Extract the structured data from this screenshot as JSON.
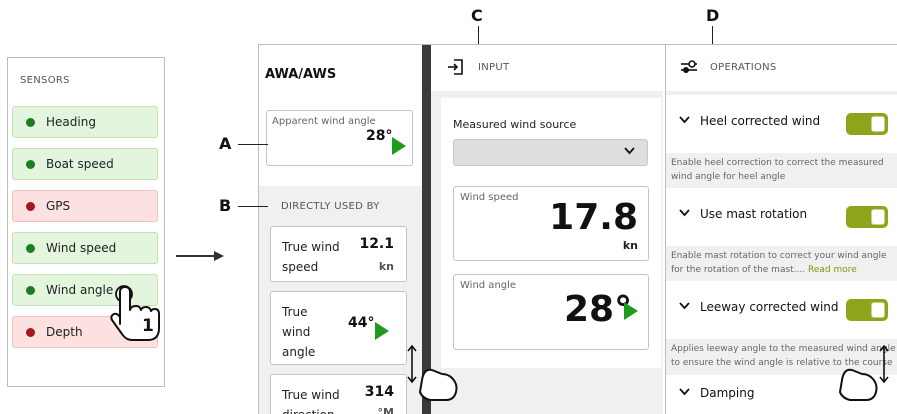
{
  "sensors": {
    "title": "SENSORS",
    "items": [
      {
        "label": "Heading",
        "status": "ok"
      },
      {
        "label": "Boat speed",
        "status": "ok"
      },
      {
        "label": "GPS",
        "status": "error"
      },
      {
        "label": "Wind speed",
        "status": "ok"
      },
      {
        "label": "Wind angle",
        "status": "ok"
      },
      {
        "label": "Depth",
        "status": "error"
      }
    ],
    "touch_step": "1"
  },
  "callouts": {
    "a": "A",
    "b": "B",
    "c": "C",
    "d": "D"
  },
  "column1": {
    "title": "AWA/AWS",
    "apparent_wind": {
      "label": "Apparent wind angle",
      "value": "28°"
    },
    "directly_used_by": {
      "title": "DIRECTLY USED BY",
      "cards": [
        {
          "name": "True wind speed",
          "value": "12.1",
          "unit": "kn"
        },
        {
          "name": "True wind angle",
          "value": "44°"
        },
        {
          "name": "True wind direction",
          "value": "314",
          "unit": "°M"
        }
      ]
    }
  },
  "column2": {
    "header": "INPUT",
    "source_label": "Measured wind source",
    "source_value": "",
    "wind_speed": {
      "label": "Wind speed",
      "value": "17.8",
      "unit": "kn"
    },
    "wind_angle": {
      "label": "Wind angle",
      "value": "28°"
    }
  },
  "column3": {
    "header": "OPERATIONS",
    "operations": [
      {
        "name": "Heel corrected wind",
        "enabled": true,
        "description_line1": "Enable heel correction to correct the measured",
        "description_line2": "wind angle for heel angle"
      },
      {
        "name": "Use mast rotation",
        "enabled": true,
        "description_line1": "Enable mast rotation to correct your wind angle",
        "description_line2": "for the rotation of the mast....",
        "read_more": "Read more"
      },
      {
        "name": "Leeway corrected wind",
        "enabled": true,
        "description_line1": "Applies leeway angle to the measured wind angle",
        "description_line2": "to ensure the wind angle is relative to the course"
      },
      {
        "name": "Damping"
      }
    ]
  },
  "colors": {
    "ok": "#1e7d22",
    "error": "#a71818",
    "toggle": "#8fa41b",
    "accent_play": "#1e9b1e"
  }
}
